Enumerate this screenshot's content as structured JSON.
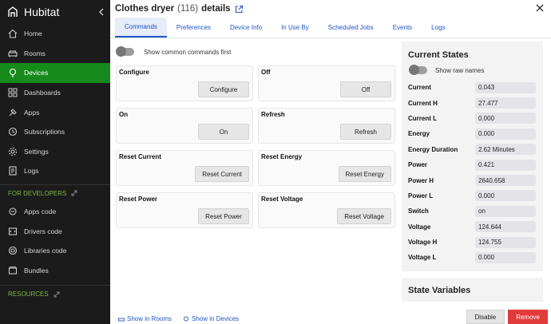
{
  "app": {
    "brand": "Hubitat"
  },
  "sidebar": {
    "items": [
      {
        "label": "Home",
        "icon": "home-icon"
      },
      {
        "label": "Rooms",
        "icon": "sofa-icon"
      },
      {
        "label": "Devices",
        "icon": "bulb-icon",
        "active": true
      },
      {
        "label": "Dashboards",
        "icon": "grid-icon"
      },
      {
        "label": "Apps",
        "icon": "apps-icon"
      },
      {
        "label": "Subscriptions",
        "icon": "subscriptions-icon"
      },
      {
        "label": "Settings",
        "icon": "gear-icon"
      },
      {
        "label": "Logs",
        "icon": "logs-icon"
      }
    ],
    "developers_label": "FOR DEVELOPERS",
    "dev_items": [
      {
        "label": "Apps code",
        "icon": "apps-code-icon"
      },
      {
        "label": "Drivers code",
        "icon": "drivers-code-icon"
      },
      {
        "label": "Libraries code",
        "icon": "libraries-code-icon"
      },
      {
        "label": "Bundles",
        "icon": "bundles-icon"
      }
    ],
    "resources_label": "RESOURCES"
  },
  "header": {
    "title": "Clothes dryer",
    "count": "(116)",
    "tail": "details"
  },
  "tabs": [
    "Commands",
    "Preferences",
    "Device Info",
    "In Use By",
    "Scheduled Jobs",
    "Events",
    "Logs"
  ],
  "common_toggle_label": "Show common commands first",
  "commands": [
    {
      "label": "Configure",
      "button": "Configure"
    },
    {
      "label": "Off",
      "button": "Off"
    },
    {
      "label": "On",
      "button": "On"
    },
    {
      "label": "Refresh",
      "button": "Refresh"
    },
    {
      "label": "Reset Current",
      "button": "Reset Current"
    },
    {
      "label": "Reset Energy",
      "button": "Reset Energy"
    },
    {
      "label": "Reset Power",
      "button": "Reset Power"
    },
    {
      "label": "Reset Voltage",
      "button": "Reset Voltage"
    }
  ],
  "current_states": {
    "title": "Current States",
    "raw_names_label": "Show raw names",
    "rows": [
      {
        "k": "Current",
        "v": "0.043"
      },
      {
        "k": "Current H",
        "v": "27.477"
      },
      {
        "k": "Current L",
        "v": "0.000"
      },
      {
        "k": "Energy",
        "v": "0.000"
      },
      {
        "k": "Energy Duration",
        "v": "2.62 Minutes"
      },
      {
        "k": "Power",
        "v": "0.421"
      },
      {
        "k": "Power H",
        "v": "2640.658"
      },
      {
        "k": "Power L",
        "v": "0.000"
      },
      {
        "k": "Switch",
        "v": "on"
      },
      {
        "k": "Voltage",
        "v": "124.644"
      },
      {
        "k": "Voltage H",
        "v": "124.755"
      },
      {
        "k": "Voltage L",
        "v": "0.000"
      }
    ]
  },
  "state_variables_title": "State Variables",
  "footer": {
    "show_in_rooms": "Show in Rooms",
    "show_in_devices": "Show in Devices"
  },
  "actions": {
    "disable": "Disable",
    "remove": "Remove"
  },
  "colors": {
    "accent": "#1f55c4",
    "active_nav": "#178a1c",
    "danger": "#e23b3b"
  }
}
